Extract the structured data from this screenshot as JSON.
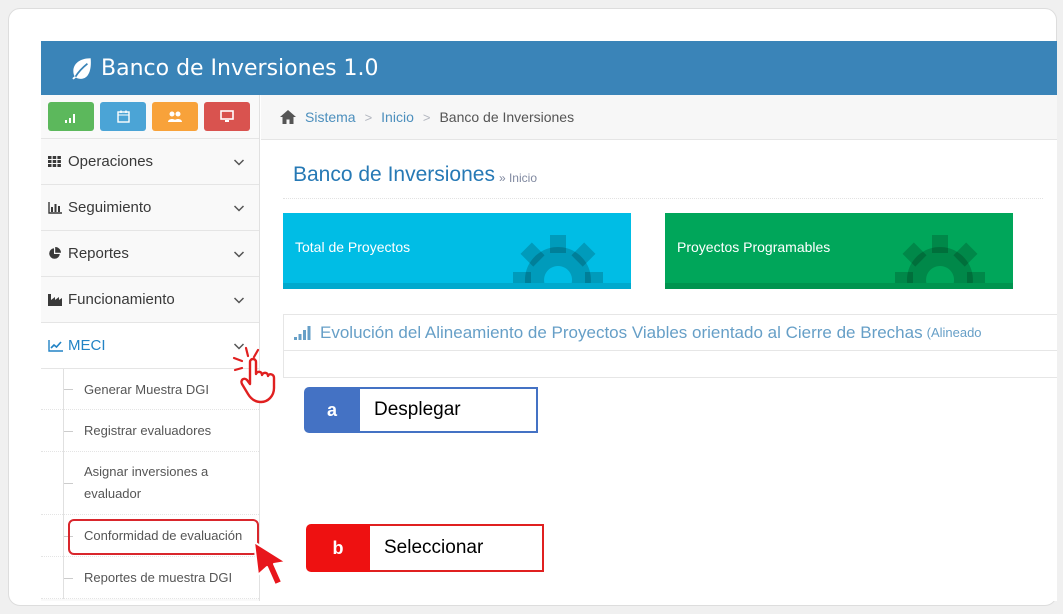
{
  "app": {
    "title": "Banco de Inversiones 1.0"
  },
  "colors": {
    "header": "#3a84b8",
    "tile_blue": "#00bde5",
    "tile_green": "#00a65a",
    "callout_a": "#4472c4",
    "callout_b": "#ee1111"
  },
  "shortcuts": [
    {
      "icon": "bar-chart-icon",
      "color": "#5cb85c"
    },
    {
      "icon": "calendar-icon",
      "color": "#4ba4d6"
    },
    {
      "icon": "users-icon",
      "color": "#f8a23a"
    },
    {
      "icon": "desktop-icon",
      "color": "#d9534f"
    }
  ],
  "sidebar": {
    "items": [
      {
        "label": "Operaciones",
        "icon": "grid-icon"
      },
      {
        "label": "Seguimiento",
        "icon": "bar-chart-icon"
      },
      {
        "label": "Reportes",
        "icon": "pie-chart-icon"
      },
      {
        "label": "Funcionamiento",
        "icon": "industry-icon"
      },
      {
        "label": "MECI",
        "icon": "line-chart-icon"
      }
    ],
    "meci_sub": [
      "Generar Muestra DGI",
      "Registrar evaluadores",
      "Asignar inversiones a evaluador",
      "Conformidad de evaluación",
      "Reportes de muestra DGI"
    ]
  },
  "breadcrumb": {
    "items": [
      "Sistema",
      "Inicio"
    ],
    "current": "Banco de Inversiones"
  },
  "page_header": {
    "title": "Banco de Inversiones",
    "subtitle": "» Inicio"
  },
  "tiles": [
    {
      "label": "Total de Proyectos",
      "icon": "gear-icon"
    },
    {
      "label": "Proyectos Programables",
      "icon": "gear-icon"
    }
  ],
  "panel": {
    "title": "Evolución del Alineamiento de Proyectos Viables orientado al Cierre de Brechas",
    "title_suffix": "(Alineado"
  },
  "callouts": {
    "a": {
      "letter": "a",
      "text": "Desplegar"
    },
    "b": {
      "letter": "b",
      "text": "Seleccionar"
    }
  }
}
